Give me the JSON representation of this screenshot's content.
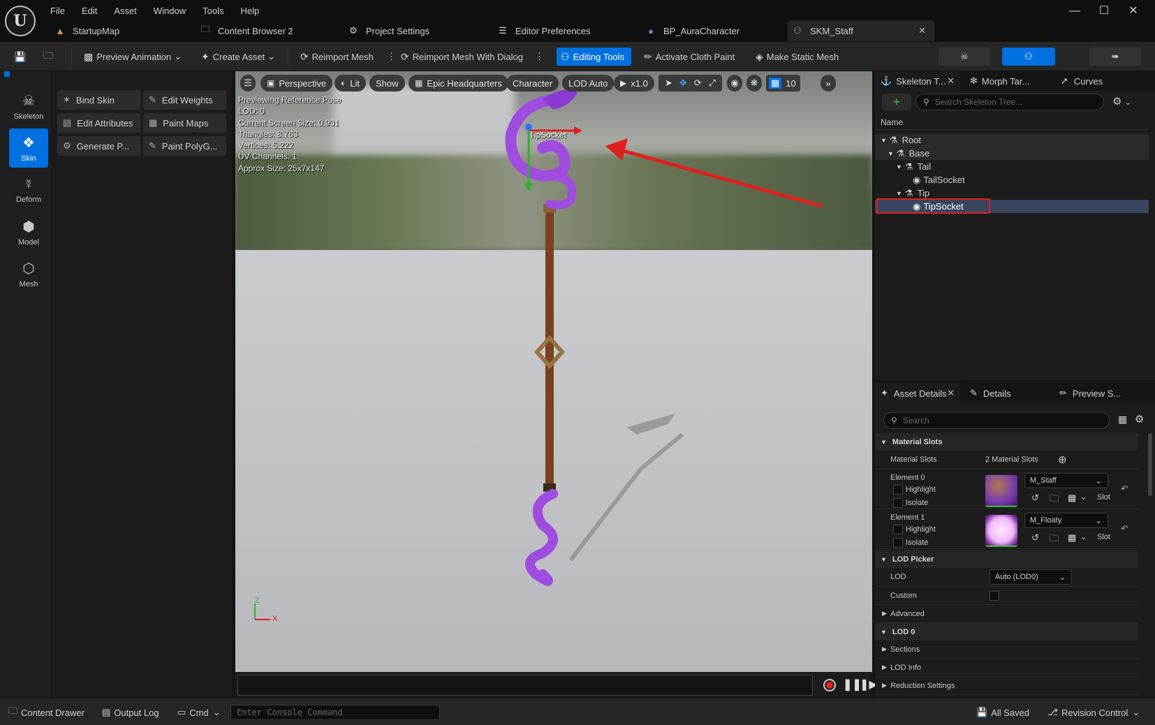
{
  "menu": {
    "items": [
      "File",
      "Edit",
      "Asset",
      "Window",
      "Tools",
      "Help"
    ]
  },
  "tabs": [
    {
      "label": "StartupMap",
      "icon": "level-icon"
    },
    {
      "label": "Content Browser 2",
      "icon": "content-browser-icon"
    },
    {
      "label": "Project Settings",
      "icon": "gear-icon"
    },
    {
      "label": "Editor Preferences",
      "icon": "sliders-icon"
    },
    {
      "label": "BP_AuraCharacter",
      "icon": "person-icon"
    },
    {
      "label": "SKM_Staff",
      "icon": "skeletal-mesh-icon"
    }
  ],
  "toolbar": {
    "preview_animation": "Preview Animation",
    "create_asset": "Create Asset",
    "reimport_mesh": "Reimport Mesh",
    "reimport_dialog": "Reimport Mesh With Dialog",
    "editing_tools": "Editing Tools",
    "activate_cloth": "Activate Cloth Paint",
    "make_static": "Make Static Mesh"
  },
  "modes": [
    {
      "label": "Skeleton",
      "icon": "skeleton-icon"
    },
    {
      "label": "Skin",
      "icon": "skin-icon",
      "selected": true
    },
    {
      "label": "Deform",
      "icon": "deform-icon"
    },
    {
      "label": "Model",
      "icon": "model-icon"
    },
    {
      "label": "Mesh",
      "icon": "mesh-icon"
    }
  ],
  "tools": [
    "Bind Skin",
    "Edit Weights",
    "Edit Attributes",
    "Paint Maps",
    "Generate P...",
    "Paint PolyG..."
  ],
  "viewport": {
    "perspective": "Perspective",
    "lit": "Lit",
    "show": "Show",
    "environment": "Epic Headquarters",
    "character": "Character",
    "lod": "LOD Auto",
    "speed": "x1.0",
    "grid_value": "10",
    "stats": [
      "Previewing Reference Pose",
      "LOD: 0",
      "Current Screen Size: 0.931",
      "Triangles: 8,763",
      "Vertices: 5,222",
      "UV Channels: 1",
      "Approx Size: 25x7x147"
    ],
    "socket_label": "TipSocket",
    "axis_z": "Z",
    "axis_x": "X"
  },
  "skeleton_panel": {
    "tabs": [
      "Skeleton T...",
      "Morph Tar...",
      "Curves"
    ],
    "search_placeholder": "Search Skeleton Tree...",
    "column": "Name",
    "tree": [
      {
        "label": "Root",
        "indent": 0
      },
      {
        "label": "Base",
        "indent": 1
      },
      {
        "label": "Tail",
        "indent": 2
      },
      {
        "label": "TailSocket",
        "indent": 3
      },
      {
        "label": "Tip",
        "indent": 2
      },
      {
        "label": "TipSocket",
        "indent": 3
      }
    ]
  },
  "details": {
    "tabs": [
      "Asset Details",
      "Details",
      "Preview S..."
    ],
    "search_placeholder": "Search",
    "material_slots_header": "Material Slots",
    "material_slots_label": "Material Slots",
    "material_slots_value": "2 Material Slots",
    "elements": [
      {
        "label": "Element 0",
        "material": "M_Staff",
        "highlight": "Highlight",
        "isolate": "Isolate",
        "slot": "Slot"
      },
      {
        "label": "Element 1",
        "material": "M_Floaty",
        "highlight": "Highlight",
        "isolate": "Isolate",
        "slot": "Slot"
      }
    ],
    "lod_picker_header": "LOD Picker",
    "lod_label": "LOD",
    "lod_value": "Auto (LOD0)",
    "custom_label": "Custom",
    "advanced": "Advanced",
    "lod0_header": "LOD 0",
    "sections": "Sections",
    "lod_info": "LOD Info",
    "reduction": "Reduction Settings"
  },
  "statusbar": {
    "content_drawer": "Content Drawer",
    "output_log": "Output Log",
    "cmd": "Cmd",
    "console_placeholder": "Enter Console Command",
    "all_saved": "All Saved",
    "revision": "Revision Control"
  },
  "colors": {
    "accent": "#0070e0",
    "annotation": "#e02020",
    "staff_purple": "#a04ce0",
    "staff_wood": "#7a4020"
  }
}
